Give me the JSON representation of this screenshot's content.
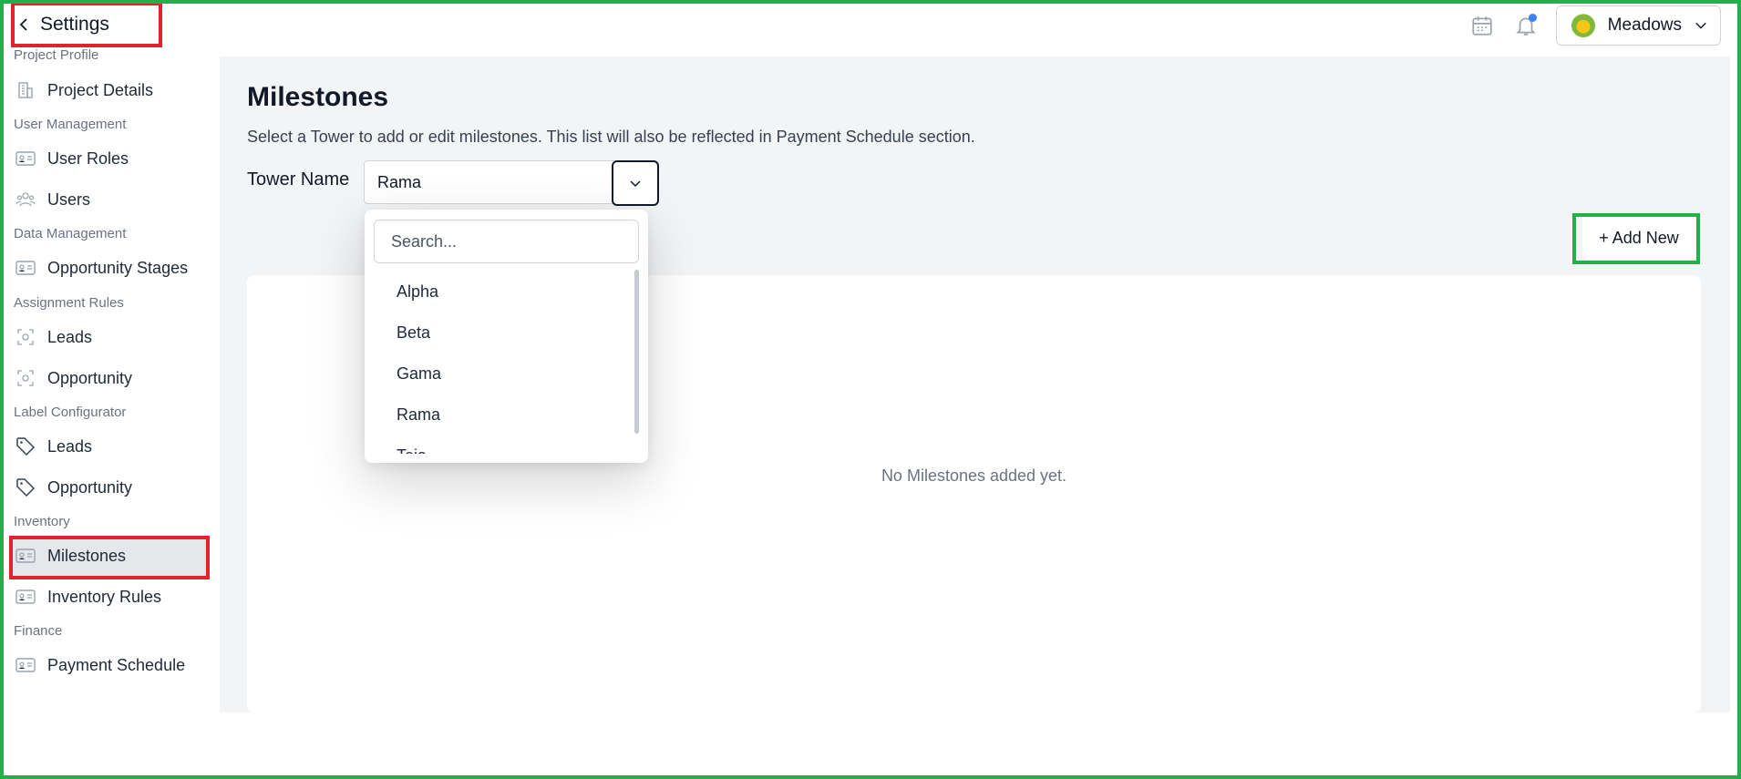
{
  "header": {
    "back_label": "Settings",
    "org_name": "Meadows",
    "icons": [
      "calendar-icon",
      "bell-icon",
      "chevron-down-icon"
    ]
  },
  "sidebar": {
    "sections": [
      {
        "label": "Project Profile",
        "items": [
          {
            "label": "Project Details",
            "icon": "building-icon"
          }
        ]
      },
      {
        "label": "User Management",
        "items": [
          {
            "label": "User Roles",
            "icon": "id-card-icon"
          },
          {
            "label": "Users",
            "icon": "users-icon"
          }
        ]
      },
      {
        "label": "Data Management",
        "items": [
          {
            "label": "Opportunity Stages",
            "icon": "id-card-icon"
          }
        ]
      },
      {
        "label": "Assignment Rules",
        "items": [
          {
            "label": "Leads",
            "icon": "focus-icon"
          },
          {
            "label": "Opportunity",
            "icon": "focus-icon"
          }
        ]
      },
      {
        "label": "Label Configurator",
        "items": [
          {
            "label": "Leads",
            "icon": "tag-icon"
          },
          {
            "label": "Opportunity",
            "icon": "tag-icon"
          }
        ]
      },
      {
        "label": "Inventory",
        "items": [
          {
            "label": "Milestones",
            "icon": "id-card-icon",
            "active": true
          },
          {
            "label": "Inventory Rules",
            "icon": "id-card-icon"
          }
        ]
      },
      {
        "label": "Finance",
        "items": [
          {
            "label": "Payment Schedule",
            "icon": "id-card-icon"
          }
        ]
      }
    ]
  },
  "main": {
    "title": "Milestones",
    "subtitle": "Select a Tower to add or edit milestones. This list will also be reflected in Payment Schedule section.",
    "tower_label": "Tower Name",
    "tower_selected": "Rama",
    "add_label": "+ Add New",
    "empty_text": "No Milestones added yet."
  },
  "dropdown": {
    "search_placeholder": "Search...",
    "options": [
      "Alpha",
      "Beta",
      "Gama",
      "Rama",
      "Teja"
    ]
  }
}
